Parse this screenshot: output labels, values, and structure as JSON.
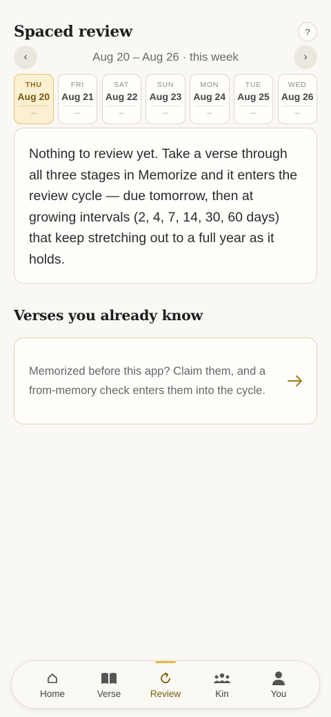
{
  "header": {
    "title": "Spaced review",
    "help_label": "?"
  },
  "week": {
    "label": "Aug 20 – Aug 26 · this week",
    "prev_label": "‹",
    "next_label": "›"
  },
  "days": [
    {
      "name": "THU",
      "date": "Aug 20",
      "count": "–",
      "active": true
    },
    {
      "name": "FRI",
      "date": "Aug 21",
      "count": "–"
    },
    {
      "name": "SAT",
      "date": "Aug 22",
      "count": "–"
    },
    {
      "name": "SUN",
      "date": "Aug 23",
      "count": "–"
    },
    {
      "name": "MON",
      "date": "Aug 24",
      "count": "–"
    },
    {
      "name": "TUE",
      "date": "Aug 25",
      "count": "–"
    },
    {
      "name": "WED",
      "date": "Aug 26",
      "count": "–"
    }
  ],
  "empty_state": {
    "text": "Nothing to review yet. Take a verse through all three stages in Memorize and it enters the review cycle — due tomorrow, then at growing intervals (2, 4, 7, 14, 30, 60 days) that keep stretching out to a full year as it holds."
  },
  "known": {
    "title": "Verses you already know",
    "card_text": "Memorized before this app? Claim them, and a from-memory check enters them into the cycle."
  },
  "tabs": [
    {
      "label": "Home",
      "icon": "home-icon"
    },
    {
      "label": "Verse",
      "icon": "book-icon"
    },
    {
      "label": "Review",
      "icon": "refresh-icon",
      "active": true
    },
    {
      "label": "Kin",
      "icon": "people-icon"
    },
    {
      "label": "You",
      "icon": "person-icon"
    }
  ],
  "colors": {
    "accent": "#e2b94a",
    "accent_text": "#7a5a0a",
    "background": "#faf8f4"
  }
}
